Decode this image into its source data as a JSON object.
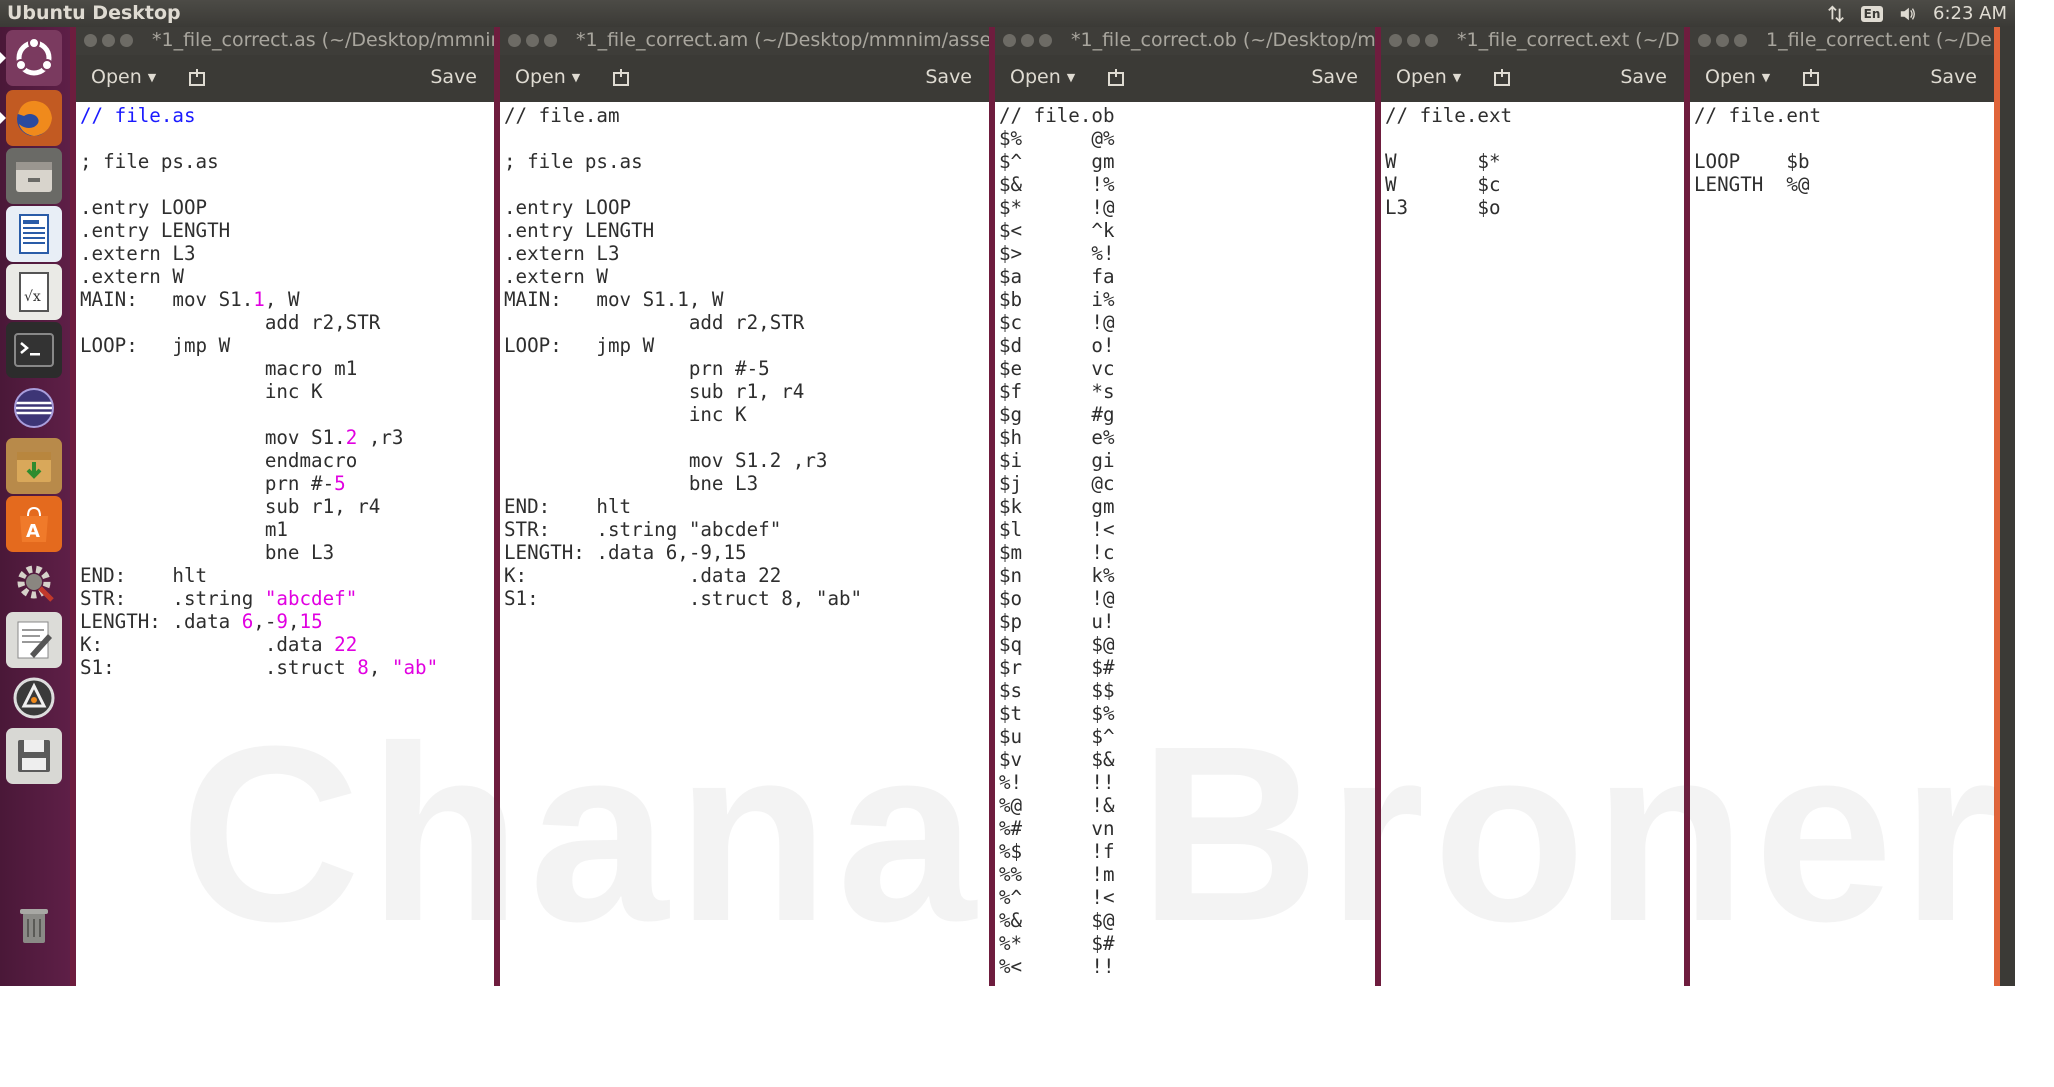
{
  "topbar": {
    "title": "Ubuntu Desktop",
    "keyboard_label": "En",
    "time": "6:23 AM"
  },
  "launcher": {
    "items": [
      {
        "name": "ubuntu-dash-icon"
      },
      {
        "name": "firefox-icon"
      },
      {
        "name": "files-icon"
      },
      {
        "name": "writer-icon"
      },
      {
        "name": "math-icon"
      },
      {
        "name": "terminal-icon"
      },
      {
        "name": "eclipse-icon"
      },
      {
        "name": "archive-manager-icon"
      },
      {
        "name": "software-center-icon"
      },
      {
        "name": "system-settings-icon"
      },
      {
        "name": "text-editor-icon"
      },
      {
        "name": "software-updater-icon"
      },
      {
        "name": "save-drive-icon"
      },
      {
        "name": "trash-icon"
      }
    ]
  },
  "windows": [
    {
      "title": "*1_file_correct.as (~/Desktop/mmnim",
      "open_label": "Open",
      "save_label": "Save",
      "lines": [
        [
          {
            "t": "// file.as",
            "c": "cm"
          }
        ],
        [
          {
            "t": ""
          }
        ],
        [
          {
            "t": "; file ps.as"
          }
        ],
        [
          {
            "t": ""
          }
        ],
        [
          {
            "t": ".entry LOOP"
          }
        ],
        [
          {
            "t": ".entry LENGTH"
          }
        ],
        [
          {
            "t": ".extern L3"
          }
        ],
        [
          {
            "t": ".extern W"
          }
        ],
        [
          {
            "t": "MAIN:   mov S1."
          },
          {
            "t": "1",
            "c": "num"
          },
          {
            "t": ", W"
          }
        ],
        [
          {
            "t": "                add r2,STR"
          }
        ],
        [
          {
            "t": "LOOP:   jmp W"
          }
        ],
        [
          {
            "t": "                macro m1"
          }
        ],
        [
          {
            "t": "                inc K"
          }
        ],
        [
          {
            "t": ""
          }
        ],
        [
          {
            "t": "                mov S1."
          },
          {
            "t": "2",
            "c": "num"
          },
          {
            "t": " ,r3"
          }
        ],
        [
          {
            "t": "                endmacro"
          }
        ],
        [
          {
            "t": "                prn #-"
          },
          {
            "t": "5",
            "c": "num"
          }
        ],
        [
          {
            "t": "                sub r1, r4"
          }
        ],
        [
          {
            "t": "                m1"
          }
        ],
        [
          {
            "t": "                bne L3"
          }
        ],
        [
          {
            "t": "END:    hlt"
          }
        ],
        [
          {
            "t": "STR:    .string "
          },
          {
            "t": "\"abcdef\"",
            "c": "str"
          }
        ],
        [
          {
            "t": "LENGTH: .data "
          },
          {
            "t": "6",
            "c": "num"
          },
          {
            "t": ",-"
          },
          {
            "t": "9",
            "c": "num"
          },
          {
            "t": ","
          },
          {
            "t": "15",
            "c": "num"
          }
        ],
        [
          {
            "t": "K:              .data "
          },
          {
            "t": "22",
            "c": "num"
          }
        ],
        [
          {
            "t": "S1:             .struct "
          },
          {
            "t": "8",
            "c": "num"
          },
          {
            "t": ", "
          },
          {
            "t": "\"ab\"",
            "c": "str"
          }
        ]
      ]
    },
    {
      "title": "*1_file_correct.am (~/Desktop/mmnim/asse",
      "open_label": "Open",
      "save_label": "Save",
      "lines": [
        [
          {
            "t": "// file.am"
          }
        ],
        [
          {
            "t": ""
          }
        ],
        [
          {
            "t": "; file ps.as"
          }
        ],
        [
          {
            "t": ""
          }
        ],
        [
          {
            "t": ".entry LOOP"
          }
        ],
        [
          {
            "t": ".entry LENGTH"
          }
        ],
        [
          {
            "t": ".extern L3"
          }
        ],
        [
          {
            "t": ".extern W"
          }
        ],
        [
          {
            "t": "MAIN:   mov S1.1, W"
          }
        ],
        [
          {
            "t": "                add r2,STR"
          }
        ],
        [
          {
            "t": "LOOP:   jmp W"
          }
        ],
        [
          {
            "t": "                prn #-5"
          }
        ],
        [
          {
            "t": "                sub r1, r4"
          }
        ],
        [
          {
            "t": "                inc K"
          }
        ],
        [
          {
            "t": ""
          }
        ],
        [
          {
            "t": "                mov S1.2 ,r3"
          }
        ],
        [
          {
            "t": "                bne L3"
          }
        ],
        [
          {
            "t": "END:    hlt"
          }
        ],
        [
          {
            "t": "STR:    .string \"abcdef\""
          }
        ],
        [
          {
            "t": "LENGTH: .data 6,-9,15"
          }
        ],
        [
          {
            "t": "K:              .data 22"
          }
        ],
        [
          {
            "t": "S1:             .struct 8, \"ab\""
          }
        ]
      ]
    },
    {
      "title": "*1_file_correct.ob (~/Desktop/m",
      "open_label": "Open",
      "save_label": "Save",
      "lines": [
        [
          {
            "t": "// file.ob"
          }
        ],
        [
          {
            "t": "$%      @%"
          }
        ],
        [
          {
            "t": "$^      gm"
          }
        ],
        [
          {
            "t": "$&      !%"
          }
        ],
        [
          {
            "t": "$*      !@"
          }
        ],
        [
          {
            "t": "$<      ^k"
          }
        ],
        [
          {
            "t": "$>      %!"
          }
        ],
        [
          {
            "t": "$a      fa"
          }
        ],
        [
          {
            "t": "$b      i%"
          }
        ],
        [
          {
            "t": "$c      !@"
          }
        ],
        [
          {
            "t": "$d      o!"
          }
        ],
        [
          {
            "t": "$e      vc"
          }
        ],
        [
          {
            "t": "$f      *s"
          }
        ],
        [
          {
            "t": "$g      #g"
          }
        ],
        [
          {
            "t": "$h      e%"
          }
        ],
        [
          {
            "t": "$i      gi"
          }
        ],
        [
          {
            "t": "$j      @c"
          }
        ],
        [
          {
            "t": "$k      gm"
          }
        ],
        [
          {
            "t": "$l      !<"
          }
        ],
        [
          {
            "t": "$m      !c"
          }
        ],
        [
          {
            "t": "$n      k%"
          }
        ],
        [
          {
            "t": "$o      !@"
          }
        ],
        [
          {
            "t": "$p      u!"
          }
        ],
        [
          {
            "t": "$q      $@"
          }
        ],
        [
          {
            "t": "$r      $#"
          }
        ],
        [
          {
            "t": "$s      $$"
          }
        ],
        [
          {
            "t": "$t      $%"
          }
        ],
        [
          {
            "t": "$u      $^"
          }
        ],
        [
          {
            "t": "$v      $&"
          }
        ],
        [
          {
            "t": "%!      !!"
          }
        ],
        [
          {
            "t": "%@      !&"
          }
        ],
        [
          {
            "t": "%#      vn"
          }
        ],
        [
          {
            "t": "%$      !f"
          }
        ],
        [
          {
            "t": "%%      !m"
          }
        ],
        [
          {
            "t": "%^      !<"
          }
        ],
        [
          {
            "t": "%&      $@"
          }
        ],
        [
          {
            "t": "%*      $#"
          }
        ],
        [
          {
            "t": "%<      !!"
          }
        ]
      ]
    },
    {
      "title": "*1_file_correct.ext (~/D",
      "open_label": "Open",
      "save_label": "Save",
      "lines": [
        [
          {
            "t": "// file.ext"
          }
        ],
        [
          {
            "t": ""
          }
        ],
        [
          {
            "t": "W       $*"
          }
        ],
        [
          {
            "t": "W       $c"
          }
        ],
        [
          {
            "t": "L3      $o"
          }
        ]
      ]
    },
    {
      "title": "1_file_correct.ent (~/De",
      "open_label": "Open",
      "save_label": "Save",
      "lines": [
        [
          {
            "t": "// file.ent"
          }
        ],
        [
          {
            "t": ""
          }
        ],
        [
          {
            "t": "LOOP    $b"
          }
        ],
        [
          {
            "t": "LENGTH  %@"
          }
        ]
      ]
    }
  ],
  "watermark": "Chana  Broner"
}
